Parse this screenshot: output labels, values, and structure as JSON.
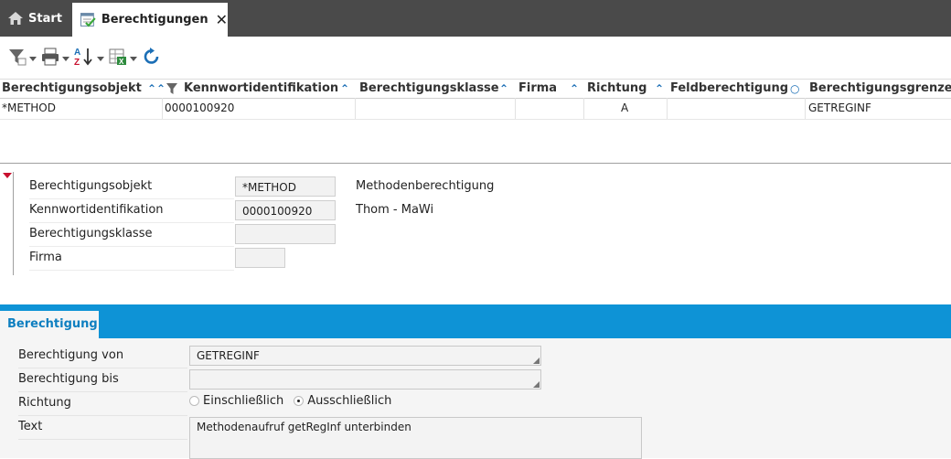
{
  "tabs": {
    "start": {
      "label": "Start",
      "icon": "home-icon"
    },
    "active": {
      "label": "Berechtigungen",
      "icon": "checklist-icon",
      "close": "✕"
    }
  },
  "toolbar": {
    "buttons": [
      {
        "name": "filter-icon"
      },
      {
        "name": "print-icon"
      },
      {
        "name": "sort-az-icon"
      },
      {
        "name": "excel-export-icon"
      },
      {
        "name": "refresh-icon"
      }
    ]
  },
  "grid": {
    "columns": [
      {
        "label": "Berechtigungsobjekt",
        "sort": "⌃⌃"
      },
      {
        "label": "Kennwortidentifikation",
        "sort": "⌃",
        "filter": true
      },
      {
        "label": "Berechtigungsklasse",
        "sort": "⌃"
      },
      {
        "label": "Firma",
        "sort": "⌃"
      },
      {
        "label": "Richtung",
        "sort": "⌃"
      },
      {
        "label": "Feldberechtigung",
        "sort": "○"
      },
      {
        "label": "Berechtigungsgrenze",
        "sort": ""
      }
    ],
    "rows": [
      [
        "*METHOD",
        "0000100920",
        "",
        "",
        "A",
        "",
        "GETREGINF"
      ]
    ]
  },
  "detail": {
    "rows": [
      {
        "label": "Berechtigungsobjekt",
        "value": "*METHOD",
        "desc": "Methodenberechtigung"
      },
      {
        "label": "Kennwortidentifikation",
        "value": "0000100920",
        "desc": "Thom - MaWi"
      },
      {
        "label": "Berechtigungsklasse",
        "value": "",
        "desc": ""
      },
      {
        "label": "Firma",
        "value": "",
        "desc": ""
      }
    ]
  },
  "section": {
    "tab_label": "Berechtigung"
  },
  "form": {
    "von": {
      "label": "Berechtigung von",
      "value": "GETREGINF"
    },
    "bis": {
      "label": "Berechtigung bis",
      "value": ""
    },
    "richtung": {
      "label": "Richtung",
      "options": [
        "Einschließlich",
        "Ausschließlich"
      ],
      "selected": "Ausschließlich"
    },
    "text": {
      "label": "Text",
      "value": "Methodenaufruf getRegInf unterbinden"
    }
  },
  "colors": {
    "accent": "#0e93d6",
    "topbar": "#4a4a4a",
    "marker": "#c8102e"
  }
}
